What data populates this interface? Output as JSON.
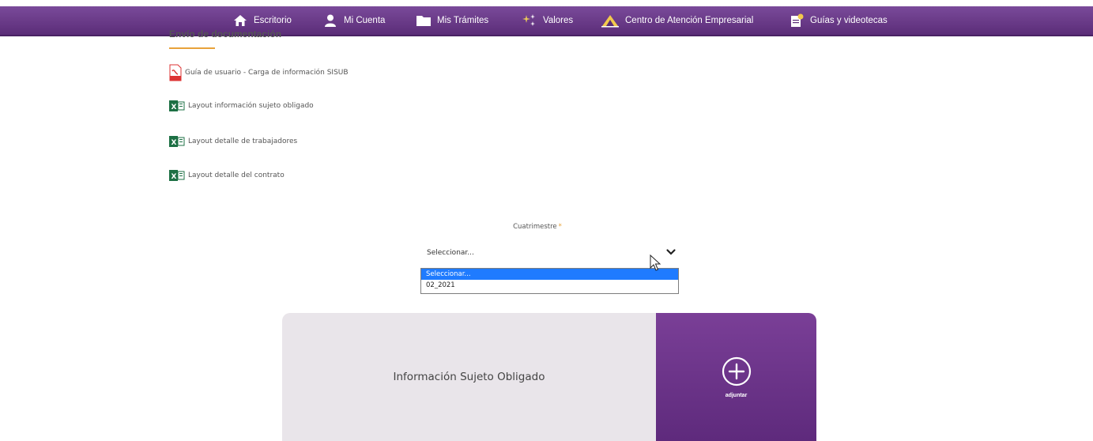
{
  "nav": {
    "items": [
      {
        "label": "Escritorio",
        "icon": "home-icon"
      },
      {
        "label": "Mi Cuenta",
        "icon": "user-icon"
      },
      {
        "label": "Mis Trámites",
        "icon": "folder-icon"
      },
      {
        "label": "Valores",
        "icon": "sparkle-icon"
      },
      {
        "label": "Centro de Atención Empresarial",
        "icon": "building-icon"
      },
      {
        "label": "Guías y videotecas",
        "icon": "guide-icon"
      }
    ],
    "colors": {
      "top": "#7a4a9a",
      "bottom": "#5b2d78"
    }
  },
  "section": {
    "title": "Envío de documentación",
    "accent_color": "#e8a23a"
  },
  "documents": [
    {
      "label": "Guía de usuario - Carga de información SISUB",
      "icon": "pdf-icon"
    },
    {
      "label": "Layout información sujeto obligado",
      "icon": "excel-icon"
    },
    {
      "label": "Layout detalle de trabajadores",
      "icon": "excel-icon"
    },
    {
      "label": "Layout detalle del contrato",
      "icon": "excel-icon"
    }
  ],
  "form": {
    "label": "Cuatrimestre",
    "required_mark": "*",
    "selected_value": "Seleccionar...",
    "options": [
      "Seleccionar...",
      "02_2021"
    ]
  },
  "upload": {
    "title": "Información Sujeto Obligado",
    "attach_label": "adjuntar",
    "panel_color": "#6b3289"
  }
}
